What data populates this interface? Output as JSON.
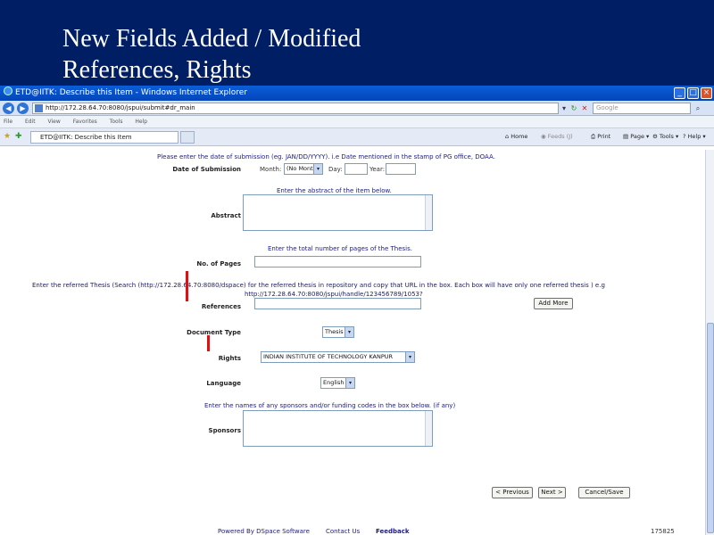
{
  "slide": {
    "title_line1": "New Fields Added / Modified",
    "title_line2": "References, Rights"
  },
  "window": {
    "title": "ETD@IITK: Describe this Item - Windows Internet Explorer",
    "address": "http://172.28.64.70:8080/jspui/submit#dr_main",
    "search_placeholder": "Google",
    "menu": [
      "File",
      "Edit",
      "View",
      "Favorites",
      "Tools",
      "Help"
    ],
    "tab_title": "ETD@IITK: Describe this Item",
    "commands": {
      "home": "Home",
      "feeds": "Feeds (J)",
      "print": "Print",
      "page": "Page",
      "tools": "Tools",
      "help": "Help"
    }
  },
  "form": {
    "submission_instr": "Please enter the date of submission (eg. JAN/DD/YYYY). i.e Date mentioned in the stamp of PG office, DOAA.",
    "date_label": "Date of Submission",
    "month_label": "Month:",
    "month_value": "(No Month)",
    "day_label": "Day:",
    "year_label": "Year:",
    "abstract_instr": "Enter the abstract of the item below.",
    "abstract_label": "Abstract",
    "pages_instr": "Enter the total number of pages of the Thesis.",
    "pages_label": "No. of Pages",
    "references_instr_1": "Enter the referred Thesis (Search (http://172.28.64.70:8080/dspace) for the referred thesis in repository and copy that URL in the box. Each box will have only one referred thesis ) e.g",
    "references_instr_2": "http://172.28.64.70:8080/jspui/handle/123456789/1053?",
    "references_label": "References",
    "add_more": "Add More",
    "doctype_label": "Document Type",
    "doctype_value": "Thesis",
    "rights_label": "Rights",
    "rights_value": "INDIAN INSTITUTE OF TECHNOLOGY KANPUR",
    "language_label": "Language",
    "language_value": "English",
    "sponsors_instr": "Enter the names of any sponsors and/or funding codes in the box below. (if any)",
    "sponsors_label": "Sponsors",
    "previous": "< Previous",
    "next": "Next >",
    "cancel": "Cancel/Save"
  },
  "footer": {
    "powered": "Powered By DSpace Software",
    "contact": "Contact Us",
    "feedback": "Feedback",
    "counter": "175825"
  },
  "colors": {
    "slide_bg": "#001e64",
    "instruction_text": "#1a1a8c",
    "mark": "#e01010"
  }
}
